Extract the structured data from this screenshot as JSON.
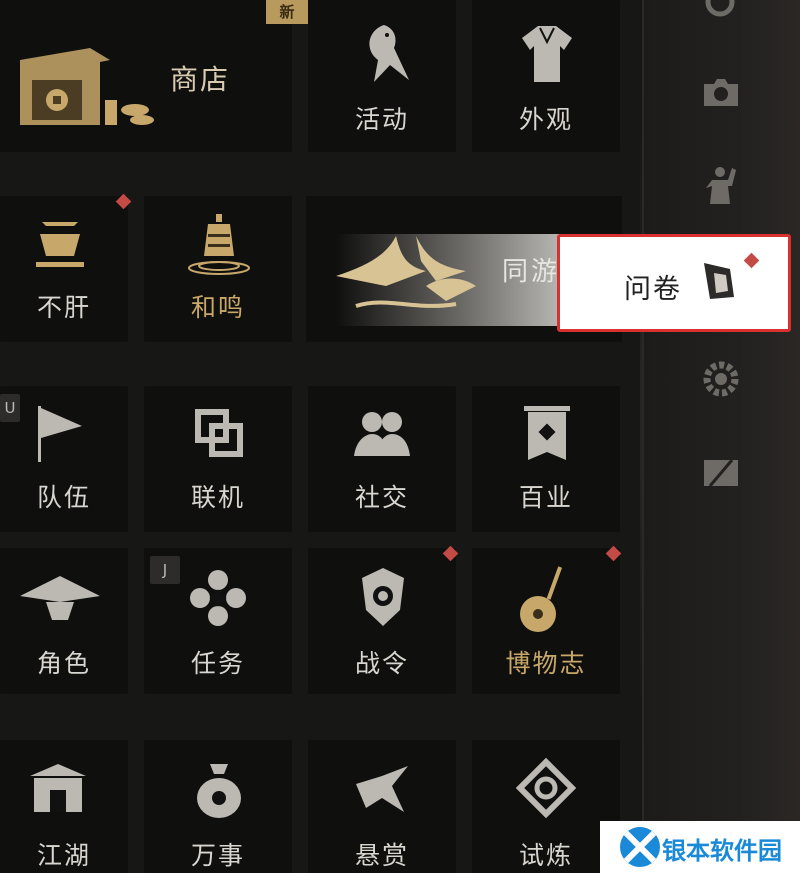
{
  "menu": {
    "new_badge": "新",
    "shop": "商店",
    "event": "活动",
    "appearance": "外观",
    "relax": "不肝",
    "harmony": "和鸣",
    "travel": "同游",
    "team": "队伍",
    "online": "联机",
    "social": "社交",
    "trades": "百业",
    "character": "角色",
    "quest": "任务",
    "battlepass": "战令",
    "museum": "博物志",
    "row5_a": "江湖",
    "row5_b": "万事",
    "row5_c": "悬赏",
    "row5_d": "试炼",
    "key_u": "U",
    "key_j": "J"
  },
  "popup": {
    "label": "问卷"
  },
  "sidebar": {
    "icons": [
      "search-icon",
      "camera-icon",
      "action-icon",
      "survey-icon",
      "settings-icon",
      "mail-icon"
    ]
  },
  "watermark": {
    "text": "银本软件园"
  },
  "colors": {
    "gold": "#c8a86a",
    "red_dot": "#c44a45",
    "highlight_border": "#d9312f",
    "watermark_blue": "#1a8ad8"
  }
}
